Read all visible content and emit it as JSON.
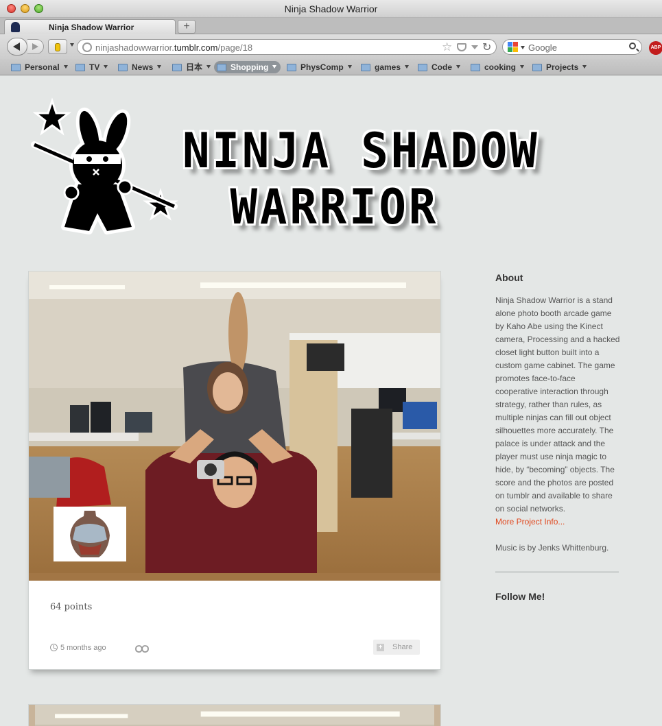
{
  "window": {
    "title": "Ninja Shadow Warrior"
  },
  "tab": {
    "label": "Ninja Shadow Warrior",
    "new_tab_symbol": "+"
  },
  "navigation": {
    "url_prefix": "ninjashadowwarrior.",
    "url_domain": "tumblr.com",
    "url_path": "/page/18",
    "search_placeholder": "Google",
    "adblock_label": "ABP"
  },
  "bookmarks": [
    "Personal",
    "TV",
    "News",
    "日本",
    "Shopping",
    "PhysComp",
    "games",
    "Code",
    "cooking",
    "Projects"
  ],
  "blog": {
    "title_line1": "Ninja Shadow",
    "title_line2": "Warrior"
  },
  "post": {
    "caption": "64 points",
    "timestamp": "5 months ago",
    "share_label": "Share"
  },
  "sidebar": {
    "about_heading": "About",
    "about_text": "Ninja Shadow Warrior is a stand alone photo booth arcade game by Kaho Abe using the Kinect camera, Processing and a hacked closet light button built into a custom game cabinet. The game promotes face-to-face cooperative interaction through strategy, rather than rules, as multiple ninjas can fill out object silhouettes more accurately. The palace is under attack and the player must use ninja magic to hide, by “becoming” objects. The score and the photos are posted on tumblr and available to share on social networks.",
    "more_link": "More Project Info...",
    "music_credit": "Music is by Jenks Whittenburg.",
    "follow_heading": "Follow Me!"
  },
  "colors": {
    "accent_link": "#e0461c",
    "page_bg": "#e4e7e6"
  }
}
